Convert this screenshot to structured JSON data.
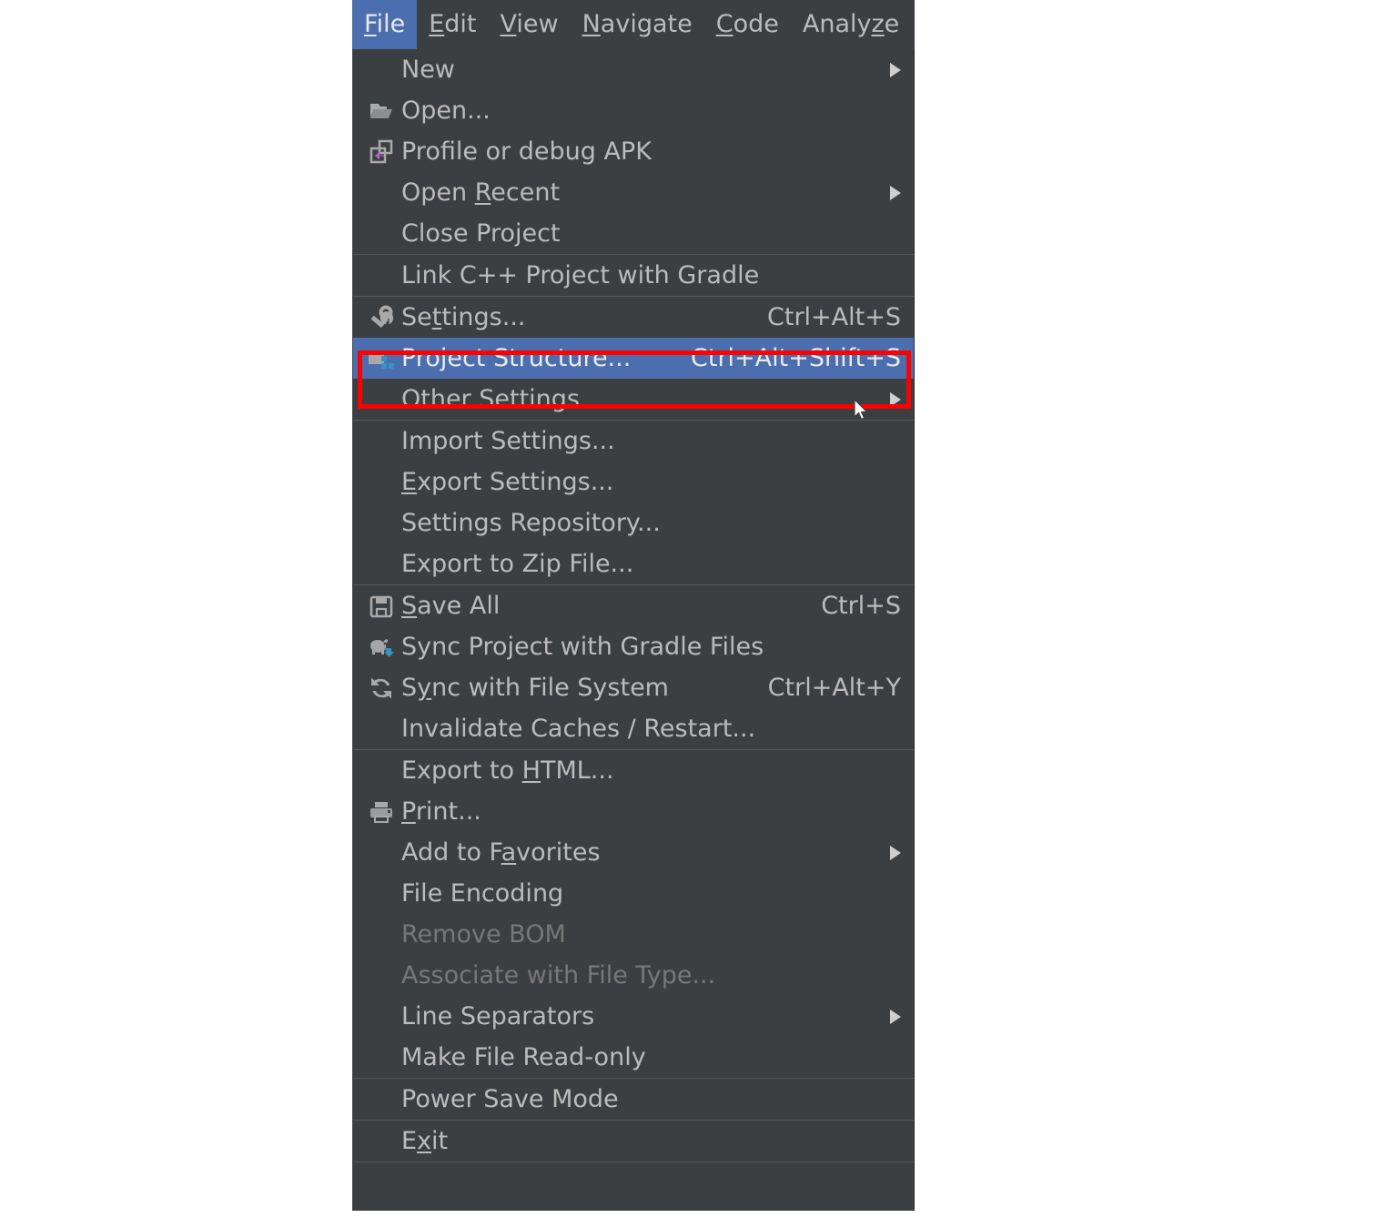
{
  "app": {
    "theme": "darcula",
    "colors": {
      "menu_background": "#3c3f41",
      "menu_text": "#bbbbbb",
      "menu_text_disabled": "#777777",
      "selection_background": "#4b6eaf",
      "selection_text": "#e9e9e9",
      "separator": "#555759",
      "annotation_red": "#ff0000",
      "icon_gray": "#a9a9a9",
      "icon_blue": "#3592c4",
      "icon_purple": "#b05fc4"
    }
  },
  "menubar": {
    "items": [
      {
        "label": "File",
        "mnemonic": "F",
        "active": true
      },
      {
        "label": "Edit",
        "mnemonic": "E",
        "active": false
      },
      {
        "label": "View",
        "mnemonic": "V",
        "active": false
      },
      {
        "label": "Navigate",
        "mnemonic": "N",
        "active": false
      },
      {
        "label": "Code",
        "mnemonic": "C",
        "active": false
      },
      {
        "label": "Analyze",
        "mnemonic": "z",
        "active": false
      }
    ]
  },
  "file_menu": {
    "groups": [
      {
        "items": [
          {
            "label": "New",
            "icon": "none",
            "submenu": true,
            "shortcut": "",
            "disabled": false,
            "selected": false
          },
          {
            "label": "Open...",
            "icon": "open-folder-icon",
            "submenu": false,
            "shortcut": "",
            "disabled": false,
            "selected": false
          },
          {
            "label": "Profile or debug APK",
            "icon": "profile-apk-icon",
            "submenu": false,
            "shortcut": "",
            "disabled": false,
            "selected": false
          },
          {
            "label": "Open Recent",
            "icon": "none",
            "submenu": true,
            "shortcut": "",
            "disabled": false,
            "selected": false,
            "mnemonic_index": 5
          },
          {
            "label": "Close Project",
            "icon": "none",
            "submenu": false,
            "shortcut": "",
            "disabled": false,
            "selected": false
          }
        ]
      },
      {
        "items": [
          {
            "label": "Link C++ Project with Gradle",
            "icon": "none",
            "submenu": false,
            "shortcut": "",
            "disabled": false,
            "selected": false
          }
        ]
      },
      {
        "items": [
          {
            "label": "Settings...",
            "icon": "wrench-icon",
            "submenu": false,
            "shortcut": "Ctrl+Alt+S",
            "disabled": false,
            "selected": false,
            "mnemonic_index": 3
          },
          {
            "label": "Project Structure...",
            "icon": "project-structure-icon",
            "submenu": false,
            "shortcut": "Ctrl+Alt+Shift+S",
            "disabled": false,
            "selected": true
          },
          {
            "label": "Other Settings",
            "icon": "none",
            "submenu": true,
            "shortcut": "",
            "disabled": false,
            "selected": false
          }
        ]
      },
      {
        "items": [
          {
            "label": "Import Settings...",
            "icon": "none",
            "submenu": false,
            "shortcut": "",
            "disabled": false,
            "selected": false
          },
          {
            "label": "Export Settings...",
            "icon": "none",
            "submenu": false,
            "shortcut": "",
            "disabled": false,
            "selected": false,
            "mnemonic_index": 0
          },
          {
            "label": "Settings Repository...",
            "icon": "none",
            "submenu": false,
            "shortcut": "",
            "disabled": false,
            "selected": false
          },
          {
            "label": "Export to Zip File...",
            "icon": "none",
            "submenu": false,
            "shortcut": "",
            "disabled": false,
            "selected": false
          }
        ]
      },
      {
        "items": [
          {
            "label": "Save All",
            "icon": "save-all-icon",
            "submenu": false,
            "shortcut": "Ctrl+S",
            "disabled": false,
            "selected": false,
            "mnemonic_index": 0
          },
          {
            "label": "Sync Project with Gradle Files",
            "icon": "gradle-sync-icon",
            "submenu": false,
            "shortcut": "",
            "disabled": false,
            "selected": false
          },
          {
            "label": "Sync with File System",
            "icon": "refresh-icon",
            "submenu": false,
            "shortcut": "Ctrl+Alt+Y",
            "disabled": false,
            "selected": false,
            "mnemonic_index": 1
          },
          {
            "label": "Invalidate Caches / Restart...",
            "icon": "none",
            "submenu": false,
            "shortcut": "",
            "disabled": false,
            "selected": false
          }
        ]
      },
      {
        "items": [
          {
            "label": "Export to HTML...",
            "icon": "none",
            "submenu": false,
            "shortcut": "",
            "disabled": false,
            "selected": false,
            "mnemonic_index": 10
          },
          {
            "label": "Print...",
            "icon": "printer-icon",
            "submenu": false,
            "shortcut": "",
            "disabled": false,
            "selected": false,
            "mnemonic_index": 0
          },
          {
            "label": "Add to Favorites",
            "icon": "none",
            "submenu": true,
            "shortcut": "",
            "disabled": false,
            "selected": false,
            "mnemonic_index": 8
          },
          {
            "label": "File Encoding",
            "icon": "none",
            "submenu": false,
            "shortcut": "",
            "disabled": false,
            "selected": false
          },
          {
            "label": "Remove BOM",
            "icon": "none",
            "submenu": false,
            "shortcut": "",
            "disabled": true,
            "selected": false
          },
          {
            "label": "Associate with File Type...",
            "icon": "none",
            "submenu": false,
            "shortcut": "",
            "disabled": true,
            "selected": false
          },
          {
            "label": "Line Separators",
            "icon": "none",
            "submenu": true,
            "shortcut": "",
            "disabled": false,
            "selected": false
          },
          {
            "label": "Make File Read-only",
            "icon": "none",
            "submenu": false,
            "shortcut": "",
            "disabled": false,
            "selected": false
          }
        ]
      },
      {
        "items": [
          {
            "label": "Power Save Mode",
            "icon": "none",
            "submenu": false,
            "shortcut": "",
            "disabled": false,
            "selected": false
          }
        ]
      },
      {
        "items": [
          {
            "label": "Exit",
            "icon": "none",
            "submenu": false,
            "shortcut": "",
            "disabled": false,
            "selected": false,
            "mnemonic_index": 1
          }
        ]
      }
    ]
  },
  "annotation": {
    "shape": "rectangle",
    "color": "#ff0000",
    "targets": "Project Structure..."
  }
}
